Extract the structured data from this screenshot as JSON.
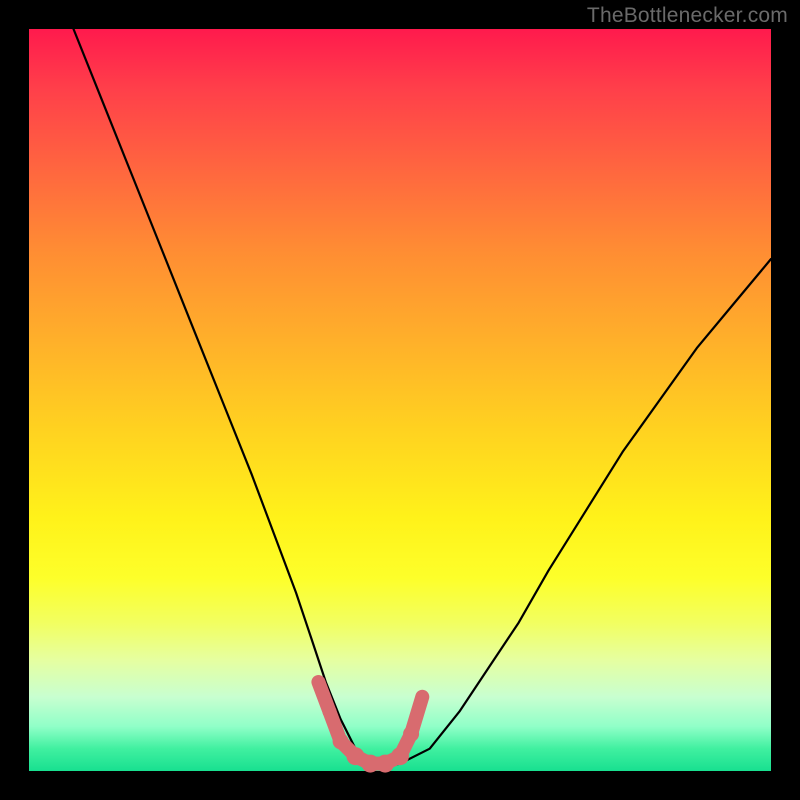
{
  "watermark": {
    "text": "TheBottlenecker.com"
  },
  "colors": {
    "background": "#000000",
    "curve": "#000000",
    "marker": "#d86b6f",
    "gradient_top": "#ff1a4d",
    "gradient_bottom": "#18e090"
  },
  "chart_data": {
    "type": "line",
    "title": "",
    "xlabel": "",
    "ylabel": "",
    "xlim": [
      0,
      100
    ],
    "ylim": [
      0,
      100
    ],
    "grid": false,
    "legend": null,
    "series": [
      {
        "name": "bottleneck-curve",
        "x": [
          6,
          10,
          14,
          18,
          22,
          26,
          30,
          33,
          36,
          38,
          40,
          42,
          44,
          46,
          48,
          50,
          54,
          58,
          62,
          66,
          70,
          75,
          80,
          85,
          90,
          95,
          100
        ],
        "y": [
          100,
          90,
          80,
          70,
          60,
          50,
          40,
          32,
          24,
          18,
          12,
          7,
          3,
          1,
          0.5,
          1,
          3,
          8,
          14,
          20,
          27,
          35,
          43,
          50,
          57,
          63,
          69
        ]
      }
    ],
    "highlight": {
      "name": "trough-markers",
      "x": [
        39,
        40.5,
        42,
        44,
        46,
        48,
        50,
        51.5,
        53
      ],
      "y": [
        12,
        8,
        4,
        2,
        1,
        1,
        2,
        5,
        10
      ],
      "size": [
        6,
        7,
        8,
        9,
        9,
        9,
        9,
        8,
        6
      ]
    }
  }
}
